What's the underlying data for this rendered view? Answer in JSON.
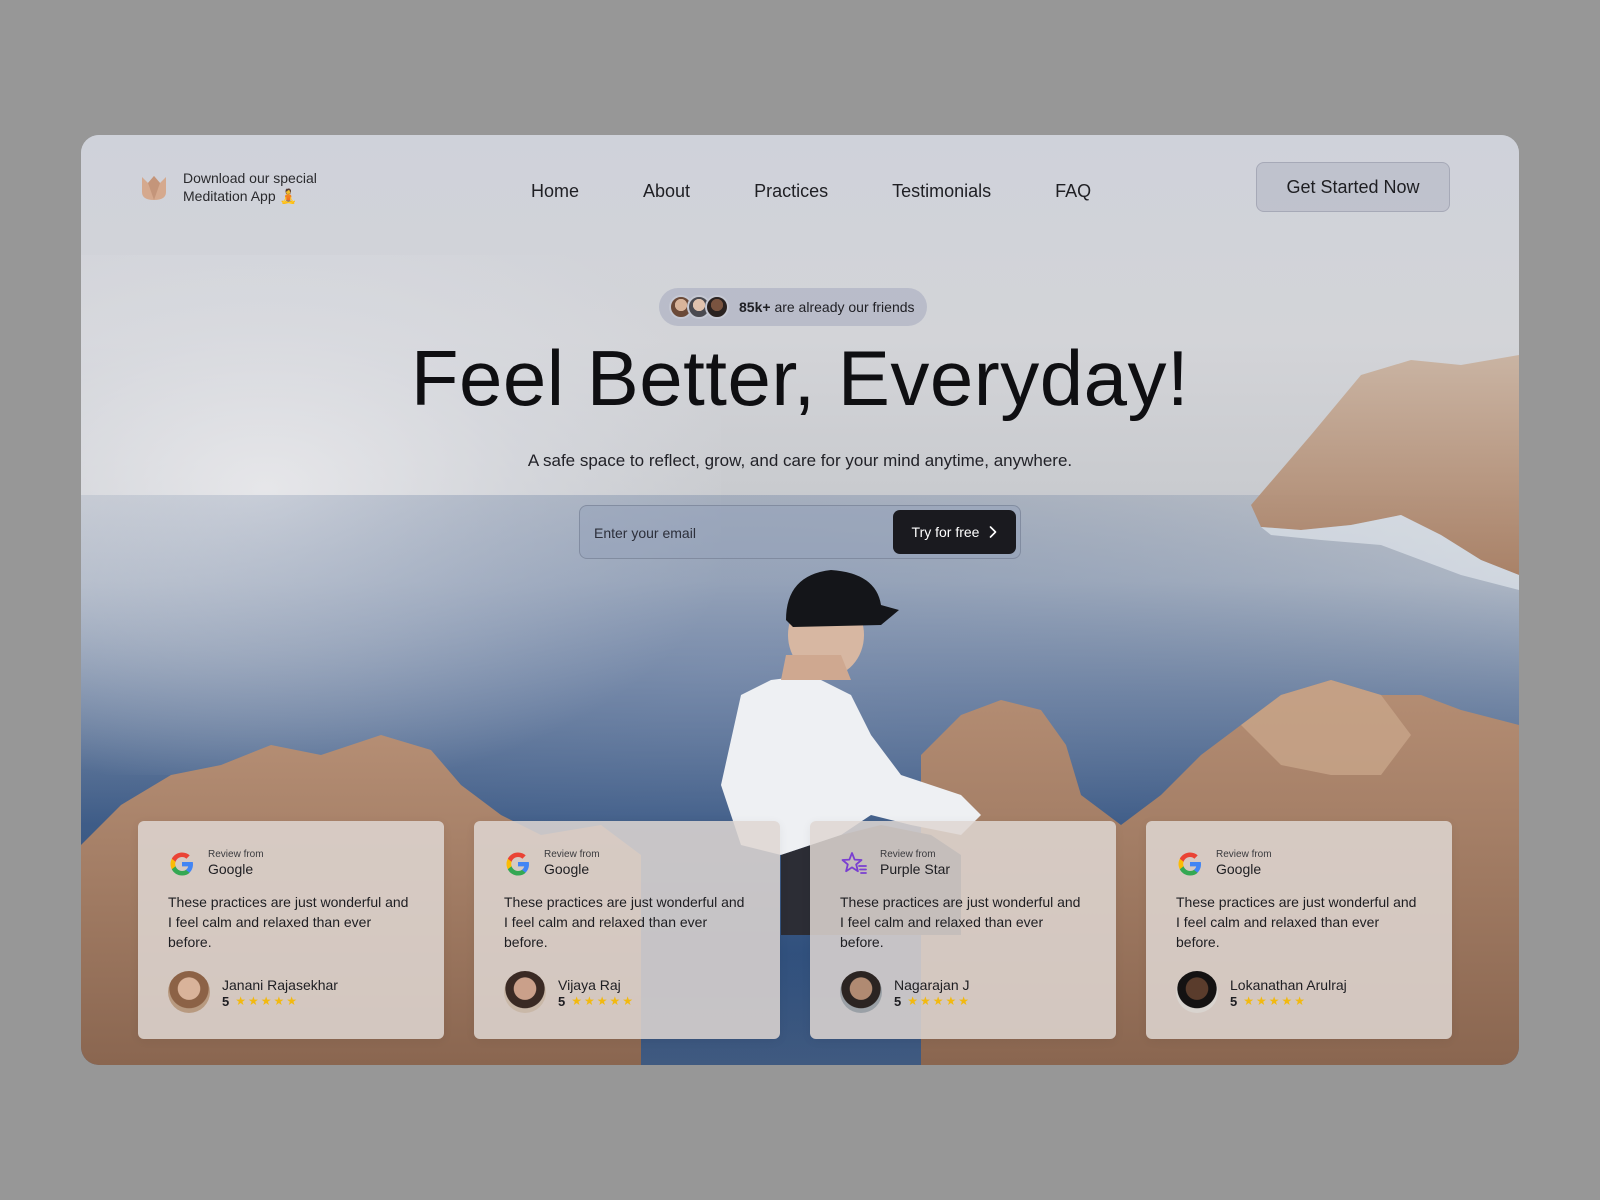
{
  "brand": {
    "line1": "Download our special",
    "line2": "Meditation App 🧘"
  },
  "nav": {
    "items": [
      "Home",
      "About",
      "Practices",
      "Testimonials",
      "FAQ"
    ],
    "cta_label": "Get Started Now"
  },
  "hero": {
    "friends_count": "85k+",
    "friends_text": "are already our friends",
    "headline": "Feel Better, Everyday!",
    "subline": "A safe space to reflect, grow, and care for your mind anytime, anywhere.",
    "email_placeholder": "Enter your email",
    "try_label": "Try for free"
  },
  "reviews": [
    {
      "source_label": "Review from",
      "source": "Google",
      "source_icon": "google-icon",
      "text": "These practices are just wonderful and I feel calm and relaxed than ever before.",
      "name": "Janani Rajasekhar",
      "rating": "5",
      "stars": "★★★★★"
    },
    {
      "source_label": "Review from",
      "source": "Google",
      "source_icon": "google-icon",
      "text": "These practices are just wonderful and I feel calm and relaxed than ever before.",
      "name": "Vijaya Raj",
      "rating": "5",
      "stars": "★★★★★"
    },
    {
      "source_label": "Review from",
      "source": "Purple Star",
      "source_icon": "purple-star-icon",
      "text": "These practices are just wonderful and I feel calm and relaxed than ever before.",
      "name": "Nagarajan J",
      "rating": "5",
      "stars": "★★★★★"
    },
    {
      "source_label": "Review from",
      "source": "Google",
      "source_icon": "google-icon",
      "text": "These practices are just wonderful and I feel calm and relaxed than ever before.",
      "name": "Lokanathan Arulraj",
      "rating": "5",
      "stars": "★★★★★"
    }
  ],
  "colors": {
    "page_bg": "#979797",
    "cta_dark": "#1a1a1f",
    "star": "#f2b90f",
    "purple_star": "#7a3fd1"
  }
}
